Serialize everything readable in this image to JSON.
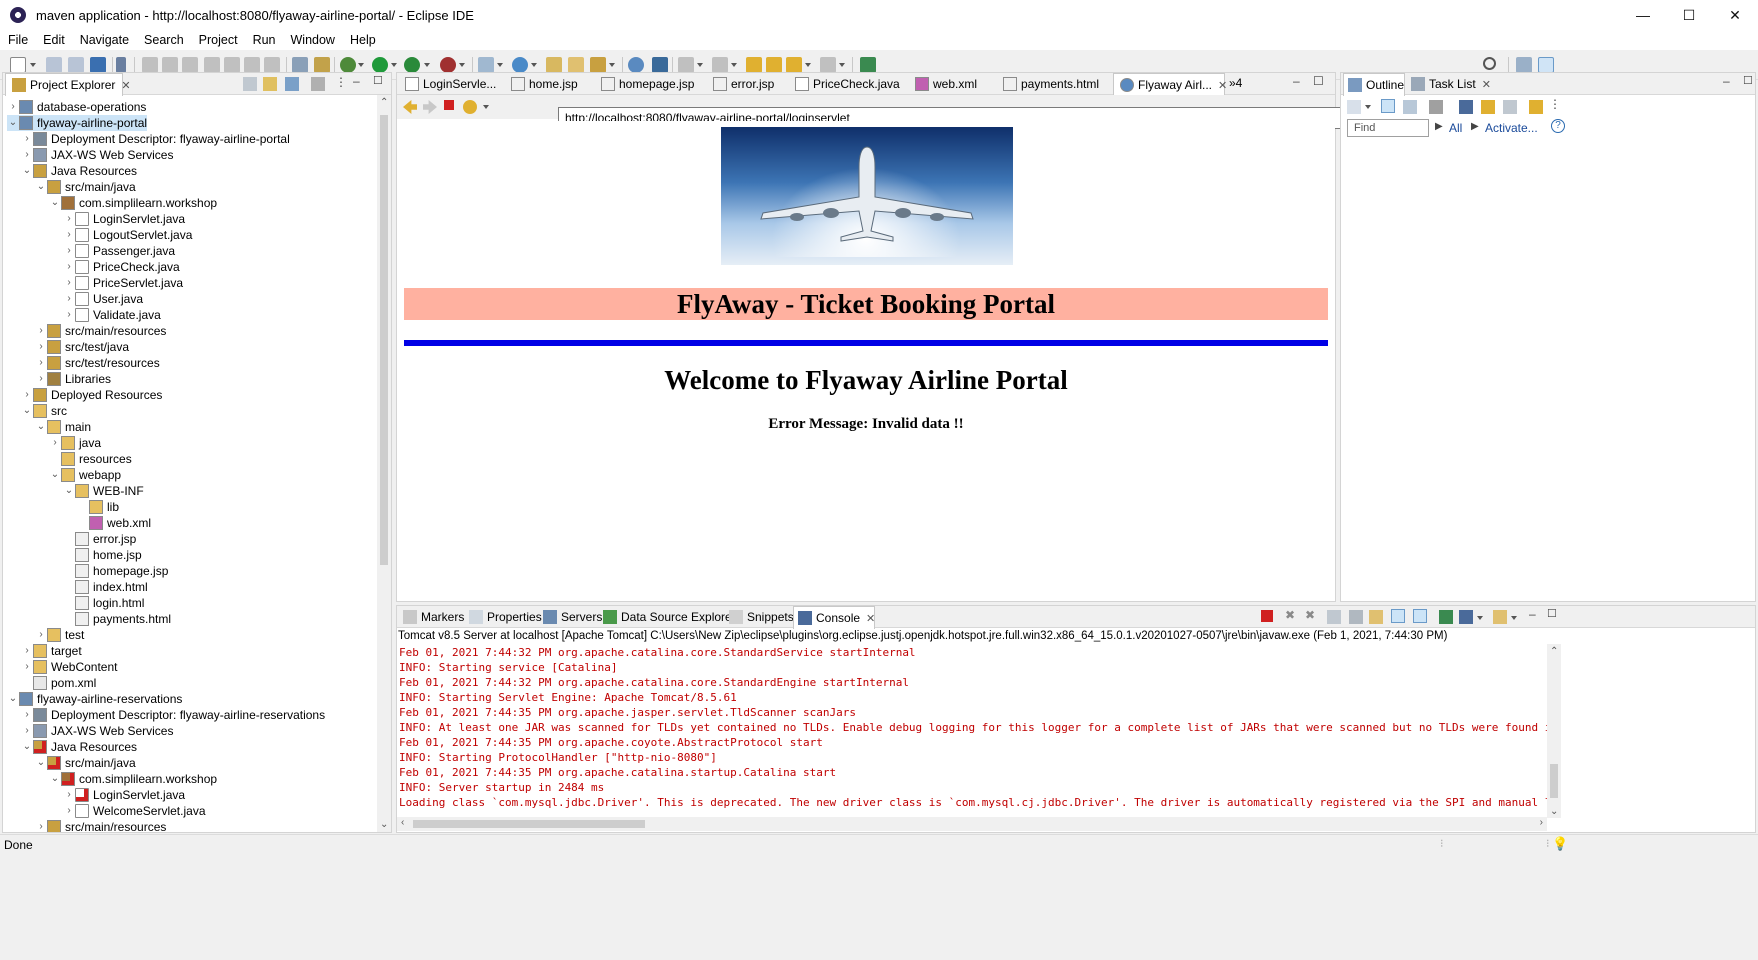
{
  "window": {
    "title": "maven application - http://localhost:8080/flyaway-airline-portal/ - Eclipse IDE",
    "buttons": {
      "minimize": "—",
      "maximize": "☐",
      "close": "✕"
    }
  },
  "menu": [
    "File",
    "Edit",
    "Navigate",
    "Search",
    "Project",
    "Run",
    "Window",
    "Help"
  ],
  "project_explorer": {
    "title": "Project Explorer",
    "tree": [
      {
        "label": "database-operations",
        "depth": 0,
        "arrow": "›",
        "icon": "project"
      },
      {
        "label": "flyaway-airline-portal",
        "depth": 0,
        "arrow": "⌄",
        "icon": "project",
        "selected": true
      },
      {
        "label": "Deployment Descriptor: flyaway-airline-portal",
        "depth": 1,
        "arrow": "›",
        "icon": "descriptor"
      },
      {
        "label": "JAX-WS Web Services",
        "depth": 1,
        "arrow": "›",
        "icon": "webservice"
      },
      {
        "label": "Java Resources",
        "depth": 1,
        "arrow": "⌄",
        "icon": "javares"
      },
      {
        "label": "src/main/java",
        "depth": 2,
        "arrow": "⌄",
        "icon": "srcfolder"
      },
      {
        "label": "com.simplilearn.workshop",
        "depth": 3,
        "arrow": "⌄",
        "icon": "package"
      },
      {
        "label": "LoginServlet.java",
        "depth": 4,
        "arrow": "›",
        "icon": "java"
      },
      {
        "label": "LogoutServlet.java",
        "depth": 4,
        "arrow": "›",
        "icon": "java"
      },
      {
        "label": "Passenger.java",
        "depth": 4,
        "arrow": "›",
        "icon": "java"
      },
      {
        "label": "PriceCheck.java",
        "depth": 4,
        "arrow": "›",
        "icon": "java"
      },
      {
        "label": "PriceServlet.java",
        "depth": 4,
        "arrow": "›",
        "icon": "java"
      },
      {
        "label": "User.java",
        "depth": 4,
        "arrow": "›",
        "icon": "java"
      },
      {
        "label": "Validate.java",
        "depth": 4,
        "arrow": "›",
        "icon": "java"
      },
      {
        "label": "src/main/resources",
        "depth": 2,
        "arrow": "›",
        "icon": "srcfolder"
      },
      {
        "label": "src/test/java",
        "depth": 2,
        "arrow": "›",
        "icon": "srcfolder"
      },
      {
        "label": "src/test/resources",
        "depth": 2,
        "arrow": "›",
        "icon": "srcfolder"
      },
      {
        "label": "Libraries",
        "depth": 2,
        "arrow": "›",
        "icon": "library"
      },
      {
        "label": "Deployed Resources",
        "depth": 1,
        "arrow": "›",
        "icon": "deployed"
      },
      {
        "label": "src",
        "depth": 1,
        "arrow": "⌄",
        "icon": "folder"
      },
      {
        "label": "main",
        "depth": 2,
        "arrow": "⌄",
        "icon": "folder"
      },
      {
        "label": "java",
        "depth": 3,
        "arrow": "›",
        "icon": "folder"
      },
      {
        "label": "resources",
        "depth": 3,
        "arrow": "",
        "icon": "folder"
      },
      {
        "label": "webapp",
        "depth": 3,
        "arrow": "⌄",
        "icon": "folder"
      },
      {
        "label": "WEB-INF",
        "depth": 4,
        "arrow": "⌄",
        "icon": "folder"
      },
      {
        "label": "lib",
        "depth": 5,
        "arrow": "",
        "icon": "folder"
      },
      {
        "label": "web.xml",
        "depth": 5,
        "arrow": "",
        "icon": "xml"
      },
      {
        "label": "error.jsp",
        "depth": 4,
        "arrow": "",
        "icon": "file"
      },
      {
        "label": "home.jsp",
        "depth": 4,
        "arrow": "",
        "icon": "file"
      },
      {
        "label": "homepage.jsp",
        "depth": 4,
        "arrow": "",
        "icon": "file"
      },
      {
        "label": "index.html",
        "depth": 4,
        "arrow": "",
        "icon": "file"
      },
      {
        "label": "login.html",
        "depth": 4,
        "arrow": "",
        "icon": "file"
      },
      {
        "label": "payments.html",
        "depth": 4,
        "arrow": "",
        "icon": "file"
      },
      {
        "label": "test",
        "depth": 2,
        "arrow": "›",
        "icon": "folder"
      },
      {
        "label": "target",
        "depth": 1,
        "arrow": "›",
        "icon": "folder"
      },
      {
        "label": "WebContent",
        "depth": 1,
        "arrow": "›",
        "icon": "folder"
      },
      {
        "label": "pom.xml",
        "depth": 1,
        "arrow": "",
        "icon": "pom"
      },
      {
        "label": "flyaway-airline-reservations",
        "depth": 0,
        "arrow": "⌄",
        "icon": "project"
      },
      {
        "label": "Deployment Descriptor: flyaway-airline-reservations",
        "depth": 1,
        "arrow": "›",
        "icon": "descriptor"
      },
      {
        "label": "JAX-WS Web Services",
        "depth": 1,
        "arrow": "›",
        "icon": "webservice"
      },
      {
        "label": "Java Resources",
        "depth": 1,
        "arrow": "⌄",
        "icon": "javares-err"
      },
      {
        "label": "src/main/java",
        "depth": 2,
        "arrow": "⌄",
        "icon": "srcfolder-err"
      },
      {
        "label": "com.simplilearn.workshop",
        "depth": 3,
        "arrow": "⌄",
        "icon": "package-err"
      },
      {
        "label": "LoginServlet.java",
        "depth": 4,
        "arrow": "›",
        "icon": "java-err"
      },
      {
        "label": "WelcomeServlet.java",
        "depth": 4,
        "arrow": "›",
        "icon": "java"
      },
      {
        "label": "src/main/resources",
        "depth": 2,
        "arrow": "›",
        "icon": "srcfolder"
      }
    ]
  },
  "editor": {
    "tabs": [
      {
        "label": "LoginServle...",
        "icon": "java"
      },
      {
        "label": "home.jsp",
        "icon": "file"
      },
      {
        "label": "homepage.jsp",
        "icon": "file"
      },
      {
        "label": "error.jsp",
        "icon": "file"
      },
      {
        "label": "PriceCheck.java",
        "icon": "java"
      },
      {
        "label": "web.xml",
        "icon": "xml"
      },
      {
        "label": "payments.html",
        "icon": "file"
      },
      {
        "label": "Flyaway Airl...",
        "icon": "globe",
        "active": true
      }
    ],
    "overflow_count": "»4",
    "url": "http://localhost:8080/flyaway-airline-portal/loginservlet"
  },
  "page": {
    "banner": "FlyAway - Ticket Booking Portal",
    "welcome": "Welcome to Flyaway Airline Portal",
    "error": "Error Message: Invalid data !!",
    "colors": {
      "banner_bg": "#ffb1a0",
      "rule": "#0000e6"
    }
  },
  "outline": {
    "tabs": [
      "Outline",
      "Task List"
    ],
    "find_placeholder": "Find",
    "all_label": "All",
    "activate_label": "Activate..."
  },
  "console": {
    "tabs": [
      "Markers",
      "Properties",
      "Servers",
      "Data Source Explorer",
      "Snippets",
      "Console"
    ],
    "header": "Tomcat v8.5 Server at localhost [Apache Tomcat] C:\\Users\\New Zip\\eclipse\\plugins\\org.eclipse.justj.openjdk.hotspot.jre.full.win32.x86_64_15.0.1.v20201027-0507\\jre\\bin\\javaw.exe  (Feb 1, 2021, 7:44:30 PM)",
    "lines": [
      "Feb 01, 2021 7:44:32 PM org.apache.catalina.core.StandardService startInternal",
      "INFO: Starting service [Catalina]",
      "Feb 01, 2021 7:44:32 PM org.apache.catalina.core.StandardEngine startInternal",
      "INFO: Starting Servlet Engine: Apache Tomcat/8.5.61",
      "Feb 01, 2021 7:44:35 PM org.apache.jasper.servlet.TldScanner scanJars",
      "INFO: At least one JAR was scanned for TLDs yet contained no TLDs. Enable debug logging for this logger for a complete list of JARs that were scanned but no TLDs were found in them. Ski",
      "Feb 01, 2021 7:44:35 PM org.apache.coyote.AbstractProtocol start",
      "INFO: Starting ProtocolHandler [\"http-nio-8080\"]",
      "Feb 01, 2021 7:44:35 PM org.apache.catalina.startup.Catalina start",
      "INFO: Server startup in 2484 ms",
      "Loading class `com.mysql.jdbc.Driver'. This is deprecated. The new driver class is `com.mysql.cj.jdbc.Driver'. The driver is automatically registered via the SPI and manual loading of t"
    ]
  },
  "status": {
    "text": "Done"
  }
}
